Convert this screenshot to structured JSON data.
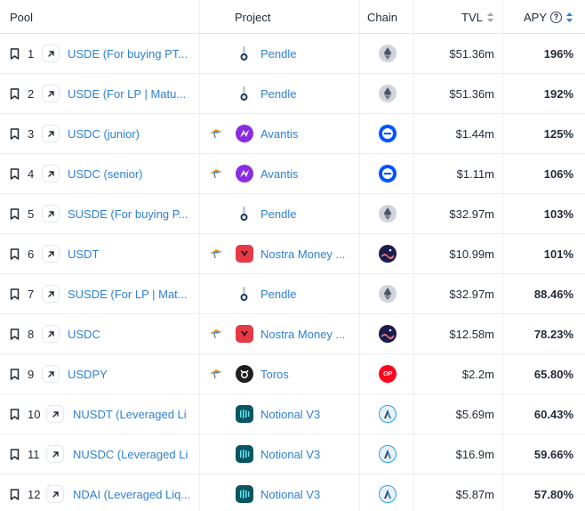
{
  "header": {
    "pool": "Pool",
    "project": "Project",
    "chain": "Chain",
    "tvl": "TVL",
    "apy": "APY"
  },
  "colors": {
    "link": "#2f80d1",
    "ethereum": "#6b7280",
    "base": "#0052ff",
    "optimism": "#ff0420",
    "arbitrum": "#2d374b",
    "avantis": "#8a2be2",
    "nostra": "#e63946",
    "notional": "#0e7490"
  },
  "rows": [
    {
      "rank": "1",
      "pool": "USDE (For buying PT...",
      "has_reward": false,
      "project": "Pendle",
      "project_icon": "pendle-icon",
      "chain": "ethereum-icon",
      "tvl": "$51.36m",
      "apy": "196%"
    },
    {
      "rank": "2",
      "pool": "USDE (For LP | Matu...",
      "has_reward": false,
      "project": "Pendle",
      "project_icon": "pendle-icon",
      "chain": "ethereum-icon",
      "tvl": "$51.36m",
      "apy": "192%"
    },
    {
      "rank": "3",
      "pool": "USDC (junior)",
      "has_reward": true,
      "project": "Avantis",
      "project_icon": "avantis-icon",
      "chain": "base-icon",
      "tvl": "$1.44m",
      "apy": "125%"
    },
    {
      "rank": "4",
      "pool": "USDC (senior)",
      "has_reward": true,
      "project": "Avantis",
      "project_icon": "avantis-icon",
      "chain": "base-icon",
      "tvl": "$1.11m",
      "apy": "106%"
    },
    {
      "rank": "5",
      "pool": "SUSDE (For buying P...",
      "has_reward": false,
      "project": "Pendle",
      "project_icon": "pendle-icon",
      "chain": "ethereum-icon",
      "tvl": "$32.97m",
      "apy": "103%"
    },
    {
      "rank": "6",
      "pool": "USDT",
      "has_reward": true,
      "project": "Nostra Money ...",
      "project_icon": "nostra-icon",
      "chain": "starknet-icon",
      "tvl": "$10.99m",
      "apy": "101%"
    },
    {
      "rank": "7",
      "pool": "SUSDE (For LP | Mat...",
      "has_reward": false,
      "project": "Pendle",
      "project_icon": "pendle-icon",
      "chain": "ethereum-icon",
      "tvl": "$32.97m",
      "apy": "88.46%"
    },
    {
      "rank": "8",
      "pool": "USDC",
      "has_reward": true,
      "project": "Nostra Money ...",
      "project_icon": "nostra-icon",
      "chain": "starknet-icon",
      "tvl": "$12.58m",
      "apy": "78.23%"
    },
    {
      "rank": "9",
      "pool": "USDPY",
      "has_reward": true,
      "project": "Toros",
      "project_icon": "toros-icon",
      "chain": "optimism-icon",
      "tvl": "$2.2m",
      "apy": "65.80%"
    },
    {
      "rank": "10",
      "pool": "NUSDT (Leveraged Li",
      "has_reward": false,
      "project": "Notional V3",
      "project_icon": "notional-icon",
      "chain": "arbitrum-icon",
      "tvl": "$5.69m",
      "apy": "60.43%"
    },
    {
      "rank": "11",
      "pool": "NUSDC (Leveraged Li",
      "has_reward": false,
      "project": "Notional V3",
      "project_icon": "notional-icon",
      "chain": "arbitrum-icon",
      "tvl": "$16.9m",
      "apy": "59.66%"
    },
    {
      "rank": "12",
      "pool": "NDAI (Leveraged Liq...",
      "has_reward": false,
      "project": "Notional V3",
      "project_icon": "notional-icon",
      "chain": "arbitrum-icon",
      "tvl": "$5.87m",
      "apy": "57.80%"
    }
  ]
}
